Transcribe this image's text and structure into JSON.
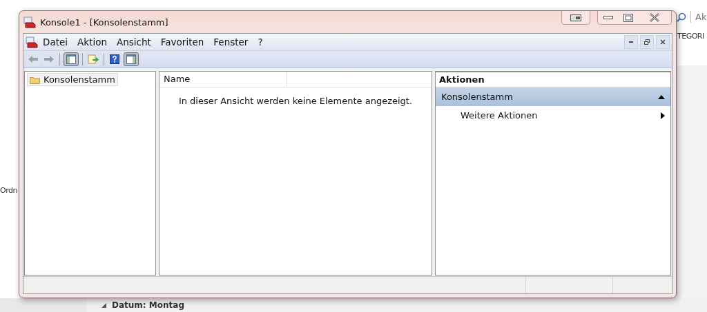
{
  "window": {
    "title": "Konsole1 - [Konsolenstamm]"
  },
  "menu": [
    "Datei",
    "Aktion",
    "Ansicht",
    "Favoriten",
    "Fenster",
    "?"
  ],
  "toolbar": [
    [
      {
        "kind": "back",
        "pressed": false
      },
      {
        "kind": "forward",
        "pressed": false
      }
    ],
    [
      {
        "kind": "tree",
        "pressed": true
      }
    ],
    [
      {
        "kind": "export",
        "pressed": false
      }
    ],
    [
      {
        "kind": "help",
        "pressed": false
      },
      {
        "kind": "pane",
        "pressed": true
      }
    ]
  ],
  "tree": [
    {
      "label": "Konsolenstamm",
      "selected": true
    }
  ],
  "list": {
    "columns": [
      "Name"
    ],
    "empty_message": "In dieser Ansicht werden keine Elemente angezeigt."
  },
  "actions": {
    "title": "Aktionen",
    "groups": [
      {
        "label": "Konsolenstamm",
        "expanded": true,
        "items": [
          "Weitere Aktionen"
        ]
      }
    ]
  },
  "background": {
    "search_placeholder": "Ak",
    "tab_label": "TEGORI",
    "side_label": "Ordn",
    "group_header": {
      "label": "Datum: Montag",
      "expanded": true
    }
  }
}
